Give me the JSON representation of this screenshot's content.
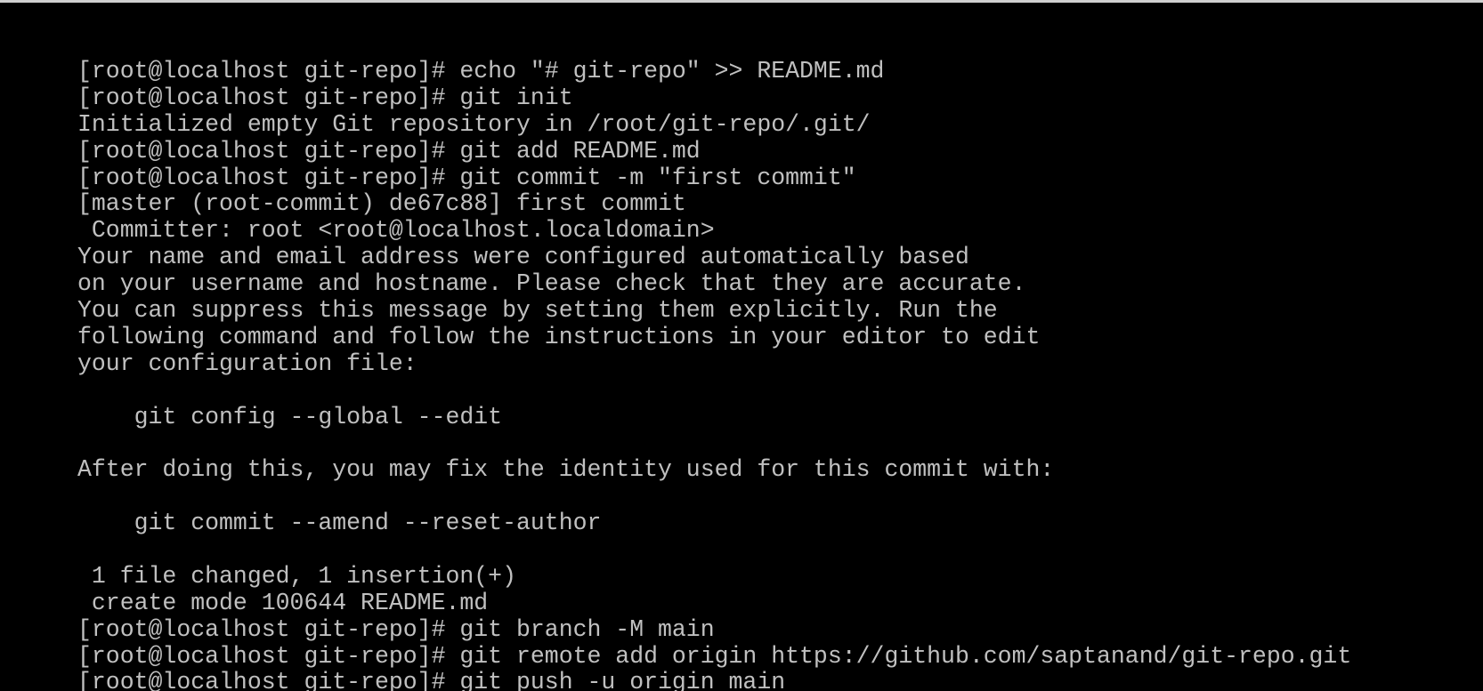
{
  "terminal": {
    "colors": {
      "background": "#000000",
      "foreground": "#c0c0c0",
      "border": "#cfcfcf"
    },
    "lines": [
      "[root@localhost git-repo]# echo \"# git-repo\" >> README.md",
      "[root@localhost git-repo]# git init",
      "Initialized empty Git repository in /root/git-repo/.git/",
      "[root@localhost git-repo]# git add README.md",
      "[root@localhost git-repo]# git commit -m \"first commit\"",
      "[master (root-commit) de67c88] first commit",
      " Committer: root <root@localhost.localdomain>",
      "Your name and email address were configured automatically based",
      "on your username and hostname. Please check that they are accurate.",
      "You can suppress this message by setting them explicitly. Run the",
      "following command and follow the instructions in your editor to edit",
      "your configuration file:",
      "",
      "    git config --global --edit",
      "",
      "After doing this, you may fix the identity used for this commit with:",
      "",
      "    git commit --amend --reset-author",
      "",
      " 1 file changed, 1 insertion(+)",
      " create mode 100644 README.md",
      "[root@localhost git-repo]# git branch -M main",
      "[root@localhost git-repo]# git remote add origin https://github.com/saptanand/git-repo.git",
      "[root@localhost git-repo]# git push -u origin main"
    ]
  }
}
